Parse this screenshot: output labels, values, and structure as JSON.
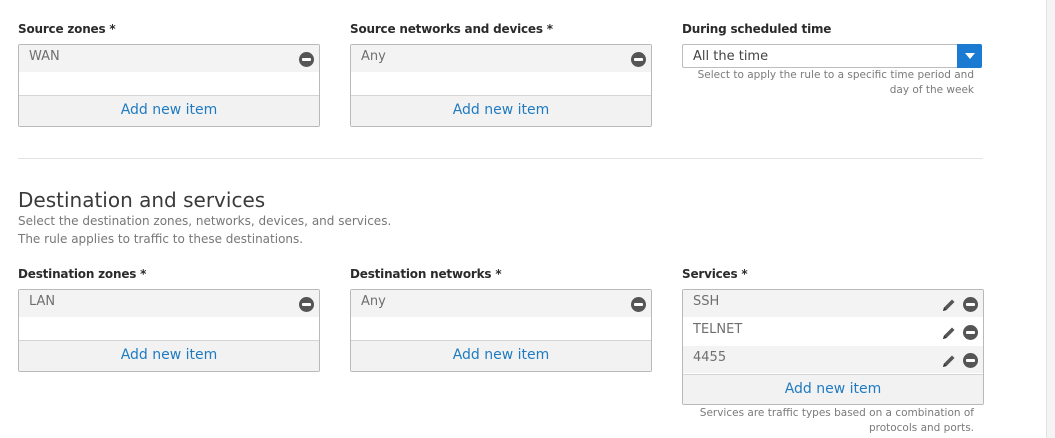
{
  "source": {
    "zones_label": "Source zones *",
    "zones_items": [
      "WAN"
    ],
    "networks_label": "Source networks and devices *",
    "networks_items": [
      "Any"
    ],
    "schedule_label": "During scheduled time",
    "schedule_value": "All the time",
    "schedule_help_line1": "Select to apply the rule to a specific time period and",
    "schedule_help_line2": "day of the week"
  },
  "destination": {
    "title": "Destination and services",
    "desc_line1": "Select the destination zones, networks, devices, and services.",
    "desc_line2": "The rule applies to traffic to these destinations.",
    "zones_label": "Destination zones *",
    "zones_items": [
      "LAN"
    ],
    "networks_label": "Destination networks *",
    "networks_items": [
      "Any"
    ],
    "services_label": "Services *",
    "services_items": [
      "SSH",
      "TELNET",
      "4455"
    ],
    "services_help_line1": "Services are traffic types based on a combination of",
    "services_help_line2": "protocols and ports."
  },
  "common": {
    "add_new_item": "Add new item"
  },
  "icons": {
    "remove": "remove-circle-icon",
    "edit": "pencil-icon",
    "dropdown": "chevron-down-icon"
  },
  "colors": {
    "link": "#1f7bc1",
    "select_button": "#1b7ad1"
  }
}
